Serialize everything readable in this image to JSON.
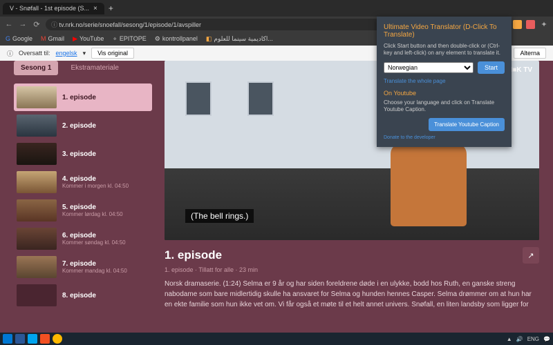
{
  "browser": {
    "tab_title": "V - Snøfall - 1st episode (S...",
    "url": "tv.nrk.no/serie/snoefall/sesong/1/episode/1/avspiller",
    "bookmarks": [
      "Google",
      "Gmail",
      "YouTube",
      "EPITOPE",
      "kontrollpanel",
      "اكاديمية سينما للعلوم..."
    ]
  },
  "translate_bar": {
    "label": "Oversatt til:",
    "lang": "engelsk",
    "show_original": "Vis original",
    "alternatives": "Alterna"
  },
  "tabs": {
    "season": "Sesong 1",
    "extra": "Ekstramateriale"
  },
  "episodes": [
    {
      "title": "1. episode",
      "sub": ""
    },
    {
      "title": "2. episode",
      "sub": ""
    },
    {
      "title": "3. episode",
      "sub": ""
    },
    {
      "title": "4. episode",
      "sub": "Kommer i morgen kl. 04:50"
    },
    {
      "title": "5. episode",
      "sub": "Kommer lørdag kl. 04:50"
    },
    {
      "title": "6. episode",
      "sub": "Kommer søndag kl. 04:50"
    },
    {
      "title": "7. episode",
      "sub": "Kommer mandag kl. 04:50"
    },
    {
      "title": "8. episode",
      "sub": ""
    }
  ],
  "player": {
    "logo": "N■K TV",
    "caption": "(The bell rings.)",
    "badge": "video"
  },
  "detail": {
    "heading": "1. episode",
    "meta": "1. episode  ·  Tillatt for alle  ·  23 min",
    "description": "Norsk dramaserie. (1:24) Selma er 9 år og har siden foreldrene døde i en ulykke, bodd hos Ruth, en ganske streng nabodame som bare midlertidig skulle ha ansvaret for Selma og hunden hennes Casper. Selma drømmer om at hun har en ekte familie som hun ikke vet om. Vi får også et møte til et helt annet univers. Snøfall, en liten landsby som ligger for"
  },
  "extension": {
    "title": "Ultimate Video Translator (D-Click To Translate)",
    "instruction": "Click Start button and then double-click or (Ctrl-key and left-click) on any element to translate it.",
    "selected_lang": "Norwegian",
    "start": "Start",
    "whole_page": "Translate the whole page",
    "youtube_h": "On Youtube",
    "youtube_txt": "Choose your language and click on Translate Youtube Caption.",
    "youtube_btn": "Translate Youtube Caption",
    "donate": "Donate to the developer"
  },
  "taskbar": {
    "lang": "ENG"
  }
}
